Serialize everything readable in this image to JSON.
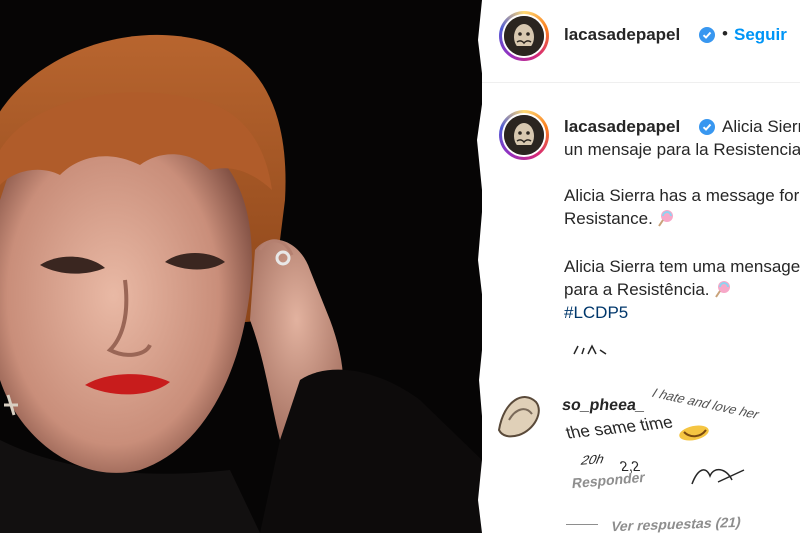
{
  "header": {
    "username": "lacasadepapel",
    "separator": "•",
    "follow_label": "Seguir"
  },
  "caption": {
    "username": "lacasadepapel",
    "line1": "Alicia Sierra tiene",
    "line2": "un mensaje para la Resistencia.",
    "line3": "Alicia Sierra has a message for the",
    "line4": "Resistance.",
    "line5": "Alicia Sierra tem uma mensagem",
    "line6": "para a Resistência.",
    "hashtag": "#LCDP5"
  },
  "comment": {
    "username": "so_pheea_",
    "text_partial": "I hate and love her",
    "text_line2": "the same time",
    "time": "20h",
    "likes": "2,2",
    "reply_label": "Responder",
    "view_replies": "Ver respuestas (21)"
  },
  "colors": {
    "accent": "#0095f6",
    "hashtag": "#00376b",
    "verified": "#3897f0",
    "text": "#262626"
  },
  "icons": {
    "verified": "verified-badge-icon",
    "emoji": "lollipop-emoji-icon"
  }
}
